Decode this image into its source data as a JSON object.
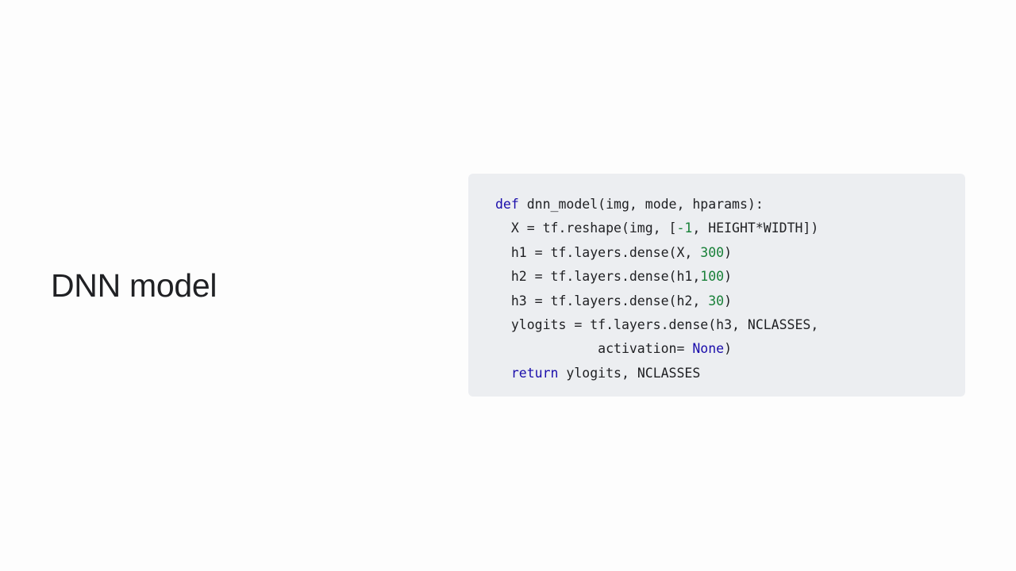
{
  "slide": {
    "title": "DNN model"
  },
  "colors": {
    "background": "#fdfdfd",
    "code_background": "#eceef1",
    "text": "#202124",
    "keyword": "#1a0dab",
    "number": "#188038"
  },
  "code": {
    "language": "python",
    "lines": [
      [
        {
          "t": "def",
          "k": "kw"
        },
        {
          "t": " dnn_model(img, mode, hparams):",
          "k": "plain"
        }
      ],
      [
        {
          "t": "  X = tf.reshape(img, [",
          "k": "plain"
        },
        {
          "t": "-1",
          "k": "num"
        },
        {
          "t": ", HEIGHT*WIDTH])",
          "k": "plain"
        }
      ],
      [
        {
          "t": "  h1 = tf.layers.dense(X, ",
          "k": "plain"
        },
        {
          "t": "300",
          "k": "num"
        },
        {
          "t": ")",
          "k": "plain"
        }
      ],
      [
        {
          "t": "  h2 = tf.layers.dense(h1,",
          "k": "plain"
        },
        {
          "t": "100",
          "k": "num"
        },
        {
          "t": ")",
          "k": "plain"
        }
      ],
      [
        {
          "t": "  h3 = tf.layers.dense(h2, ",
          "k": "plain"
        },
        {
          "t": "30",
          "k": "num"
        },
        {
          "t": ")",
          "k": "plain"
        }
      ],
      [
        {
          "t": "  ylogits = tf.layers.dense(h3, NCLASSES,",
          "k": "plain"
        }
      ],
      [
        {
          "t": "             activation= ",
          "k": "plain"
        },
        {
          "t": "None",
          "k": "kw"
        },
        {
          "t": ")",
          "k": "plain"
        }
      ],
      [
        {
          "t": "  ",
          "k": "plain"
        },
        {
          "t": "return",
          "k": "kw"
        },
        {
          "t": " ylogits, NCLASSES",
          "k": "plain"
        }
      ]
    ]
  }
}
